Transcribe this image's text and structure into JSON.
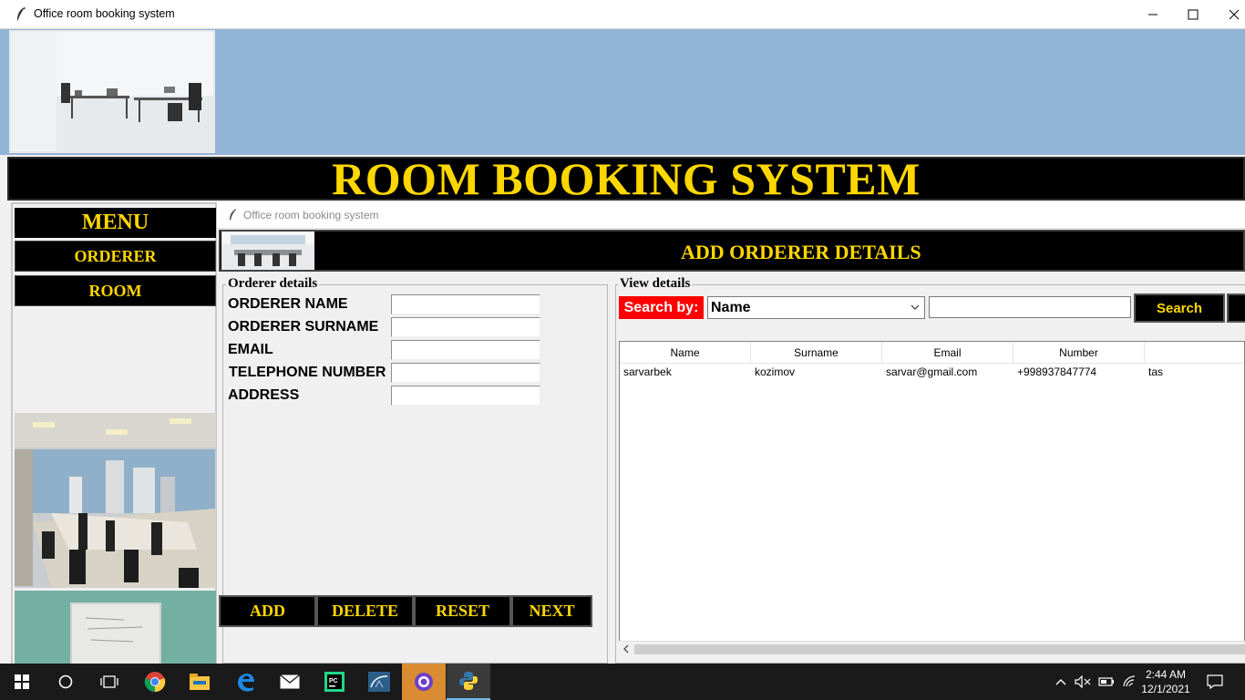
{
  "window": {
    "title": "Office room booking system"
  },
  "banner": {
    "title": "ROOM BOOKING SYSTEM"
  },
  "menu": {
    "title": "MENU",
    "items": [
      {
        "label": "ORDERER"
      },
      {
        "label": "ROOM"
      }
    ]
  },
  "subwindow": {
    "title": "Office room booking system",
    "header": "ADD ORDERER DETAILS"
  },
  "orderer_form": {
    "legend": "Orderer details",
    "fields": [
      {
        "label": "ORDERER NAME",
        "value": ""
      },
      {
        "label": "ORDERER SURNAME",
        "value": ""
      },
      {
        "label": "EMAIL",
        "value": ""
      },
      {
        "label": "TELEPHONE NUMBER",
        "value": ""
      },
      {
        "label": "ADDRESS",
        "value": ""
      }
    ],
    "buttons": [
      "ADD",
      "DELETE",
      "RESET",
      "NEXT"
    ]
  },
  "view": {
    "legend": "View details",
    "search_by_label": "Search by:",
    "search_field": "Name",
    "search_text": "",
    "search_button": "Search",
    "columns": [
      "Name",
      "Surname",
      "Email",
      "Number",
      ""
    ],
    "rows": [
      [
        "sarvarbek",
        "kozimov",
        "sarvar@gmail.com",
        "+998937847774",
        "tas"
      ]
    ]
  },
  "taskbar": {
    "time": "2:44 AM",
    "date": "12/1/2021",
    "apps": [
      "start-icon",
      "cortana-icon",
      "task-view-icon",
      "chrome-icon",
      "file-explorer-icon",
      "edge-icon",
      "mail-icon",
      "pycharm-icon",
      "mysql-workbench-icon",
      "github-desktop-icon",
      "python-icon"
    ]
  },
  "colors": {
    "accent": "#ffd700",
    "band": "#92b4d7",
    "search_label_bg": "#ff0000"
  }
}
